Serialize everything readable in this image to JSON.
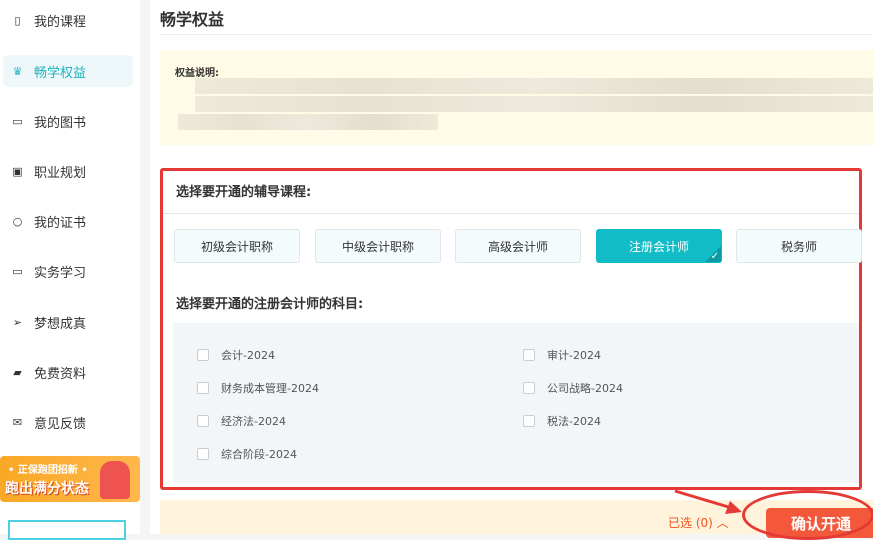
{
  "sidebar": {
    "items": [
      {
        "label": "我的课程",
        "icon": "book-icon"
      },
      {
        "label": "畅学权益",
        "icon": "crown-icon"
      },
      {
        "label": "我的图书",
        "icon": "book-closed-icon"
      },
      {
        "label": "职业规划",
        "icon": "badge-icon"
      },
      {
        "label": "我的证书",
        "icon": "bulb-icon"
      },
      {
        "label": "实务学习",
        "icon": "monitor-icon"
      },
      {
        "label": "梦想成真",
        "icon": "send-icon"
      },
      {
        "label": "免费资料",
        "icon": "folder-icon"
      },
      {
        "label": "意见反馈",
        "icon": "mail-icon"
      }
    ],
    "banner": {
      "line1": "• 正保跑团招新 •",
      "line2": "跑出满分状态"
    }
  },
  "main": {
    "title": "畅学权益",
    "notice_label": "权益说明:",
    "course_heading": "选择要开通的辅导课程:",
    "courses": [
      "初级会计职称",
      "中级会计职称",
      "高级会计师",
      "注册会计师",
      "税务师"
    ],
    "selected_course": "注册会计师",
    "subject_heading": "选择要开通的注册会计师的科目:",
    "subjects": [
      "会计-2024",
      "审计-2024",
      "财务成本管理-2024",
      "公司战略-2024",
      "经济法-2024",
      "税法-2024",
      "综合阶段-2024"
    ],
    "footer": {
      "selected": "已选 (0) ︿",
      "confirm": "确认开通"
    }
  },
  "colors": {
    "accent": "#12bcc6",
    "confirm": "#f4583a",
    "annotation": "#e53935"
  }
}
